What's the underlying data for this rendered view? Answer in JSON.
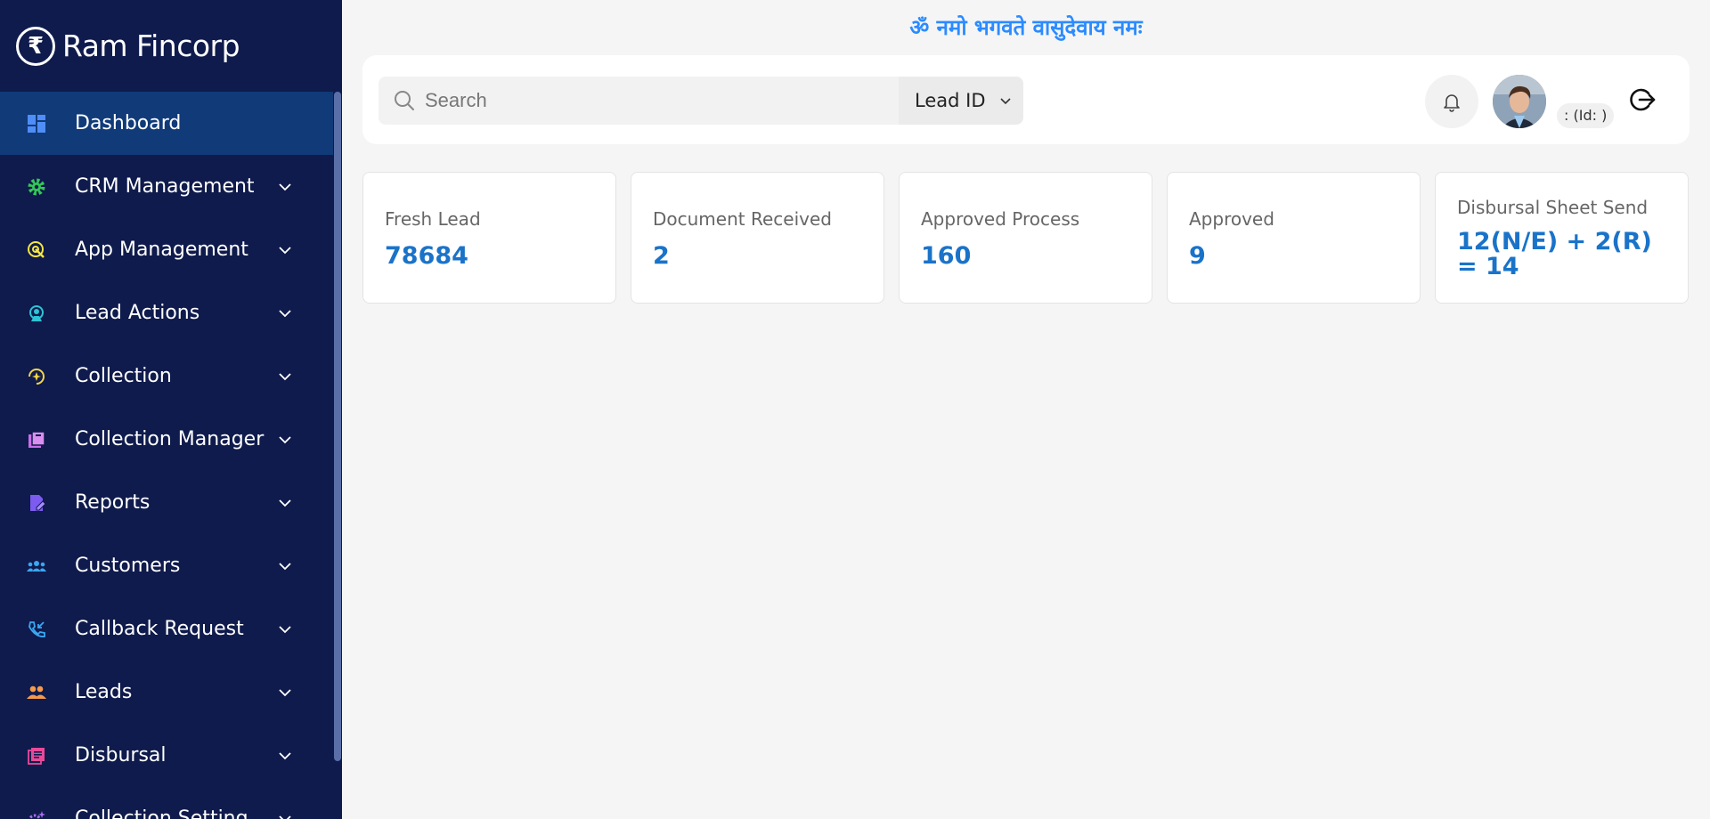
{
  "brand": {
    "name": "Ram Fincorp",
    "logo_icon": "rupee-icon"
  },
  "sidebar": {
    "items": [
      {
        "label": "Dashboard",
        "icon": "dashboard-icon",
        "color": "#4f8ef7",
        "active": true
      },
      {
        "label": "CRM Management",
        "icon": "gear-icon",
        "color": "#34c759"
      },
      {
        "label": "App Management",
        "icon": "target-icon",
        "color": "#f5e642"
      },
      {
        "label": "Lead Actions",
        "icon": "support-icon",
        "color": "#2ec4d6"
      },
      {
        "label": "Collection",
        "icon": "collection-icon",
        "color": "#f5d742"
      },
      {
        "label": "Collection Manager",
        "icon": "folder-icon",
        "color": "#c86ee8"
      },
      {
        "label": "Reports",
        "icon": "report-icon",
        "color": "#7c5cf0"
      },
      {
        "label": "Customers",
        "icon": "customers-icon",
        "color": "#3aa7f2"
      },
      {
        "label": "Callback Request",
        "icon": "phone-callback-icon",
        "color": "#3aa7f2"
      },
      {
        "label": "Leads",
        "icon": "people-icon",
        "color": "#f59a4a"
      },
      {
        "label": "Disbursal",
        "icon": "ledger-icon",
        "color": "#e84a9a"
      },
      {
        "label": "Collection Setting",
        "icon": "settings-sparkle-icon",
        "color": "#a66ef0"
      }
    ]
  },
  "header": {
    "mantra": "ॐ नमो भगवते वासुदेवाय नमः",
    "search_placeholder": "Search",
    "search_type": "Lead ID",
    "user_id_text": ": (Id: )"
  },
  "stats": [
    {
      "label": "Fresh Lead",
      "value": "78684"
    },
    {
      "label": "Document Received",
      "value": "2"
    },
    {
      "label": "Approved Process",
      "value": "160"
    },
    {
      "label": "Approved",
      "value": "9"
    },
    {
      "label": "Disbursal Sheet Send",
      "value": "12(N/E) + 2(R) = 14"
    }
  ]
}
